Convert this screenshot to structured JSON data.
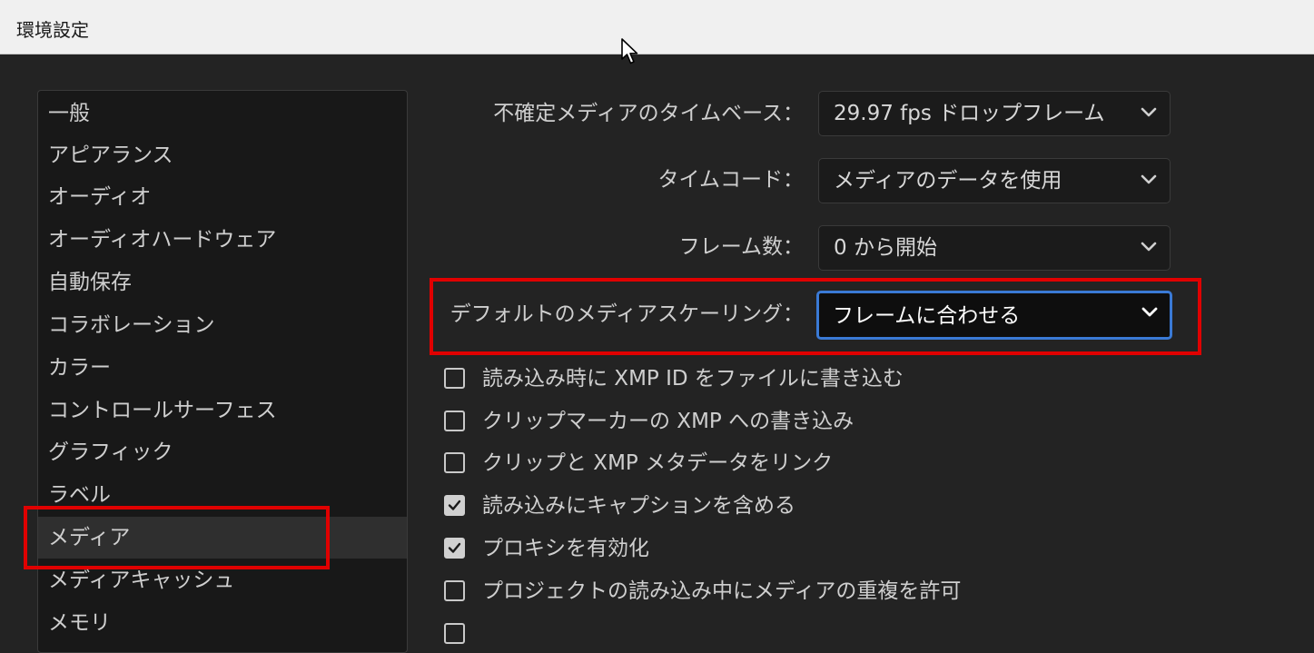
{
  "window": {
    "title": "環境設定"
  },
  "sidebar": {
    "items": [
      {
        "label": "一般"
      },
      {
        "label": "アピアランス"
      },
      {
        "label": "オーディオ"
      },
      {
        "label": "オーディオハードウェア"
      },
      {
        "label": "自動保存"
      },
      {
        "label": "コラボレーション"
      },
      {
        "label": "カラー"
      },
      {
        "label": "コントロールサーフェス"
      },
      {
        "label": "グラフィック"
      },
      {
        "label": "ラベル"
      },
      {
        "label": "メディア",
        "selected": true
      },
      {
        "label": "メディアキャッシュ"
      },
      {
        "label": "メモリ"
      }
    ]
  },
  "settings": {
    "timebase": {
      "label": "不確定メディアのタイムベース：",
      "value": "29.97 fps ドロップフレーム"
    },
    "timecode": {
      "label": "タイムコード：",
      "value": "メディアのデータを使用"
    },
    "frame_count": {
      "label": "フレーム数：",
      "value": "0 から開始"
    },
    "scaling": {
      "label": "デフォルトのメディアスケーリング：",
      "value": "フレームに合わせる"
    }
  },
  "checkboxes": [
    {
      "label": "読み込み時に XMP ID をファイルに書き込む",
      "checked": false
    },
    {
      "label": "クリップマーカーの XMP への書き込み",
      "checked": false
    },
    {
      "label": "クリップと XMP メタデータをリンク",
      "checked": false
    },
    {
      "label": "読み込みにキャプションを含める",
      "checked": true
    },
    {
      "label": "プロキシを有効化",
      "checked": true
    },
    {
      "label": "プロジェクトの読み込み中にメディアの重複を許可",
      "checked": false
    }
  ],
  "colors": {
    "highlight": "#e00000",
    "focus": "#3a7ad6",
    "background": "#232323"
  }
}
